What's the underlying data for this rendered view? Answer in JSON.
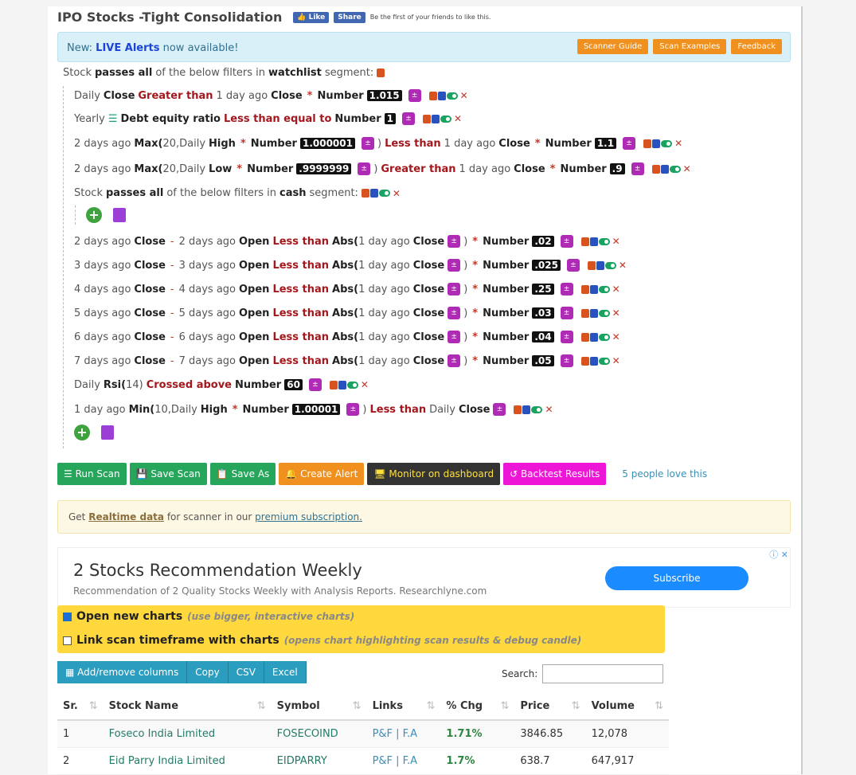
{
  "title": "IPO Stocks -Tight Consolidation",
  "fb": {
    "like": "Like",
    "share": "Share",
    "text": "Be the first of your friends to like this."
  },
  "alert": {
    "prefix": "New:",
    "live": "LIVE Alerts",
    "suffix": "now available!",
    "buttons": [
      "Scanner Guide",
      "Scan Examples",
      "Feedback"
    ]
  },
  "header": {
    "stock": "Stock",
    "passes": "passes all",
    "mid": "of the below filters in",
    "segment": "watchlist",
    "seg_word": "segment:"
  },
  "sub_header": {
    "stock": "Stock",
    "passes": "passes all",
    "mid": "of the below filters in",
    "segment": "cash",
    "seg_word": "segment:"
  },
  "conditions": [
    [
      "Daily",
      "Close",
      "Greater than",
      "1 day ago",
      "Close",
      "*",
      "Number",
      "1.015"
    ],
    [
      "Yearly",
      "Debt equity ratio",
      "Less than equal to",
      "Number",
      "1"
    ],
    [
      "2 days ago",
      "Max(",
      "20",
      ",Daily",
      "High",
      "*",
      "Number",
      "1.000001",
      ")",
      "Less than",
      "1 day ago",
      "Close",
      "*",
      "Number",
      "1.1"
    ],
    [
      "2 days ago",
      "Max(",
      "20",
      ",Daily",
      "Low",
      "*",
      "Number",
      ".9999999",
      ")",
      "Greater than",
      "1 day ago",
      "Close",
      "*",
      "Number",
      ".9"
    ]
  ],
  "sub_conditions": [
    {
      "d": "2 days ago",
      "n": ".02"
    },
    {
      "d": "3 days ago",
      "n": ".025"
    },
    {
      "d": "4 days ago",
      "n": ".25"
    },
    {
      "d": "5 days ago",
      "n": ".03"
    },
    {
      "d": "6 days ago",
      "n": ".04"
    },
    {
      "d": "7 days ago",
      "n": ".05"
    }
  ],
  "sub_words": {
    "close": "Close",
    "open": "Open",
    "lt": "Less than",
    "abs": "Abs(",
    "d1": "1 day ago",
    "close2": "Close",
    "close_paren": ")",
    "star": "*",
    "number": "Number",
    "minus": "-"
  },
  "rsi": [
    "Daily",
    "Rsi(",
    "14",
    ")",
    "Crossed above",
    "Number",
    "60"
  ],
  "min": [
    "1 day ago",
    "Min(",
    "10",
    ",Daily",
    "High",
    "*",
    "Number",
    "1.00001",
    ")",
    "Less than",
    "Daily",
    "Close"
  ],
  "actions": {
    "run": "Run Scan",
    "save": "Save Scan",
    "saveas": "Save As",
    "alert": "Create Alert",
    "monitor": "Monitor on dashboard",
    "backtest": "Backtest Results",
    "love": "5 people love this"
  },
  "realtime": {
    "get": "Get",
    "rt": "Realtime data",
    "mid": "for scanner in our",
    "premium": "premium subscription."
  },
  "ad": {
    "heading": "2 Stocks Recommendation Weekly",
    "sub": "Recommendation of 2 Quality Stocks Weekly with Analysis Reports. Researchlyne.com",
    "button": "Subscribe"
  },
  "charts": {
    "open": "Open new charts",
    "open_hint": "(use bigger, interactive charts)",
    "link": "Link scan timeframe with charts",
    "link_hint": "(opens chart highlighting scan results & debug candle)"
  },
  "table_tools": {
    "addrm": "Add/remove columns",
    "copy": "Copy",
    "csv": "CSV",
    "excel": "Excel",
    "search": "Search:"
  },
  "table": {
    "headers": [
      "Sr.",
      "Stock Name",
      "Symbol",
      "Links",
      "% Chg",
      "Price",
      "Volume"
    ],
    "rows": [
      {
        "sr": "1",
        "name": "Foseco India Limited",
        "symbol": "FOSECOIND",
        "links": "P&F | F.A",
        "chg": "1.71%",
        "price": "3846.85",
        "volume": "12,078"
      },
      {
        "sr": "2",
        "name": "Eid Parry India Limited",
        "symbol": "EIDPARRY",
        "links": "P&F | F.A",
        "chg": "1.7%",
        "price": "638.7",
        "volume": "647,917"
      }
    ]
  }
}
